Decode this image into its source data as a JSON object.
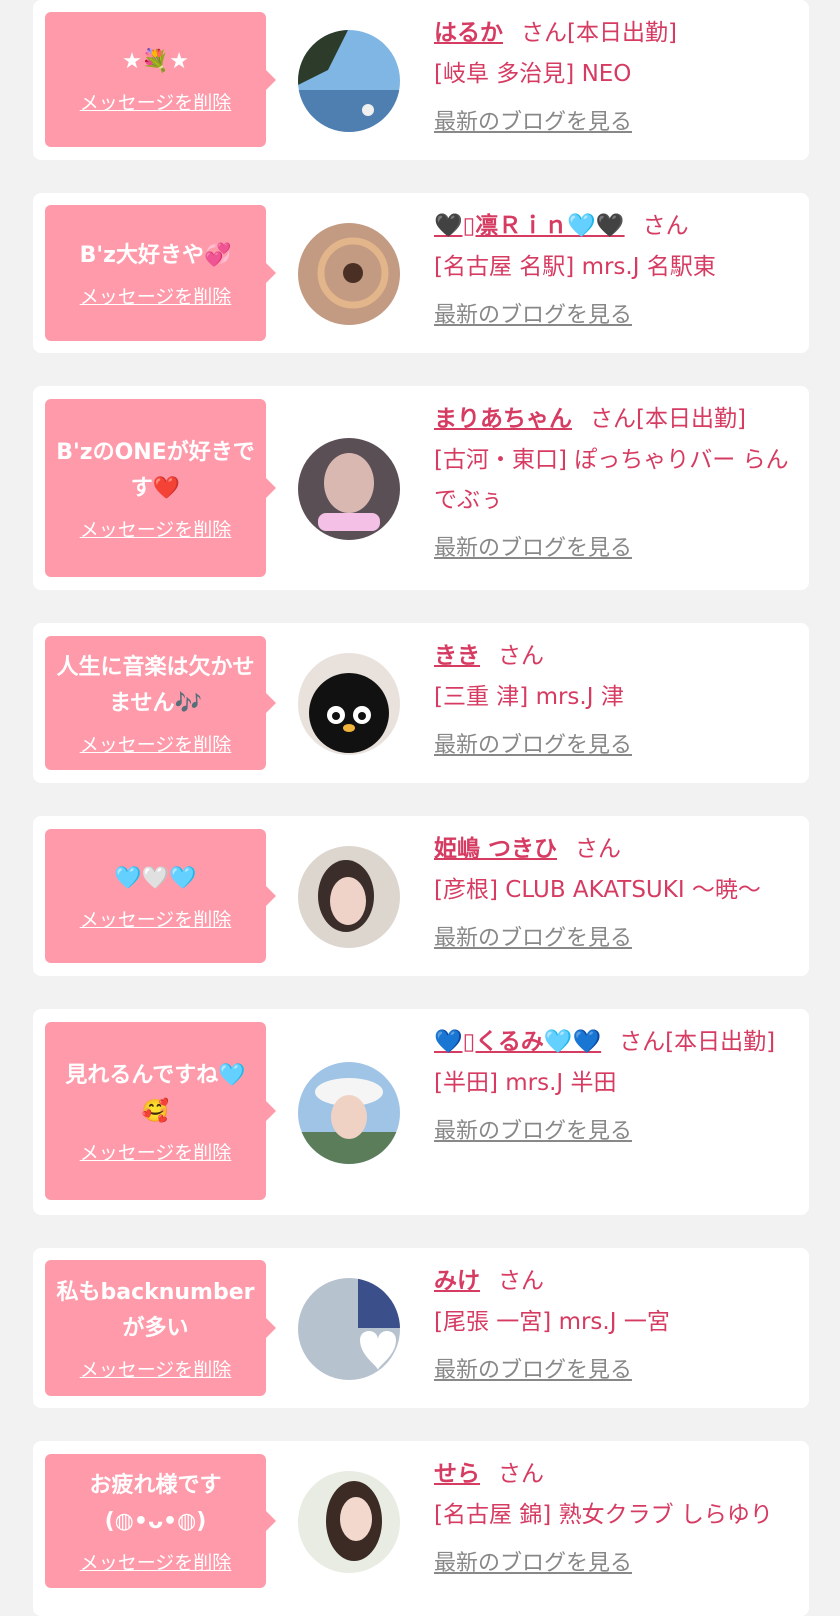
{
  "delete_label": "メッセージを削除",
  "blog_label": "最新のブログを見る",
  "honorific": "さん",
  "cards": [
    {
      "message": "★💐★",
      "name": "はるか",
      "status": "[本日出勤]",
      "shop": "[岐阜 多治見] NEO"
    },
    {
      "message": "B'z大好きや💞",
      "name": "🖤▯凛Ｒｉｎ🩵🖤",
      "status": "",
      "shop": "[名古屋 名駅] mrs.J 名駅東"
    },
    {
      "message": "B'zのONEが好きです❤️",
      "name": "まりあちゃん",
      "status": "[本日出勤]",
      "shop": "[古河・東口] ぽっちゃりバー らんでぶぅ"
    },
    {
      "message": "人生に音楽は欠かせません🎶",
      "name": "きき",
      "status": "",
      "shop": "[三重 津] mrs.J 津"
    },
    {
      "message": "🩵🤍🩵",
      "name": "姫嶋 つきひ",
      "status": "",
      "shop": "[彦根] CLUB AKATSUKI 〜暁〜"
    },
    {
      "message": "見れるんですね🩵🥰",
      "name": "💙▯くるみ🩵💙",
      "status": "[本日出勤]",
      "shop": "[半田] mrs.J 半田"
    },
    {
      "message": "私もbacknumberが多い",
      "name": "みけ",
      "status": "",
      "shop": "[尾張 一宮] mrs.J 一宮"
    },
    {
      "message": "お疲れ様です(◍•ᴗ•◍)",
      "name": "せら",
      "status": "",
      "shop": "[名古屋 錦] 熟女クラブ しらゆり"
    }
  ],
  "colors": {
    "bubble": "#ff9aaa",
    "accent": "#d63b62",
    "link_gray": "#888888"
  }
}
